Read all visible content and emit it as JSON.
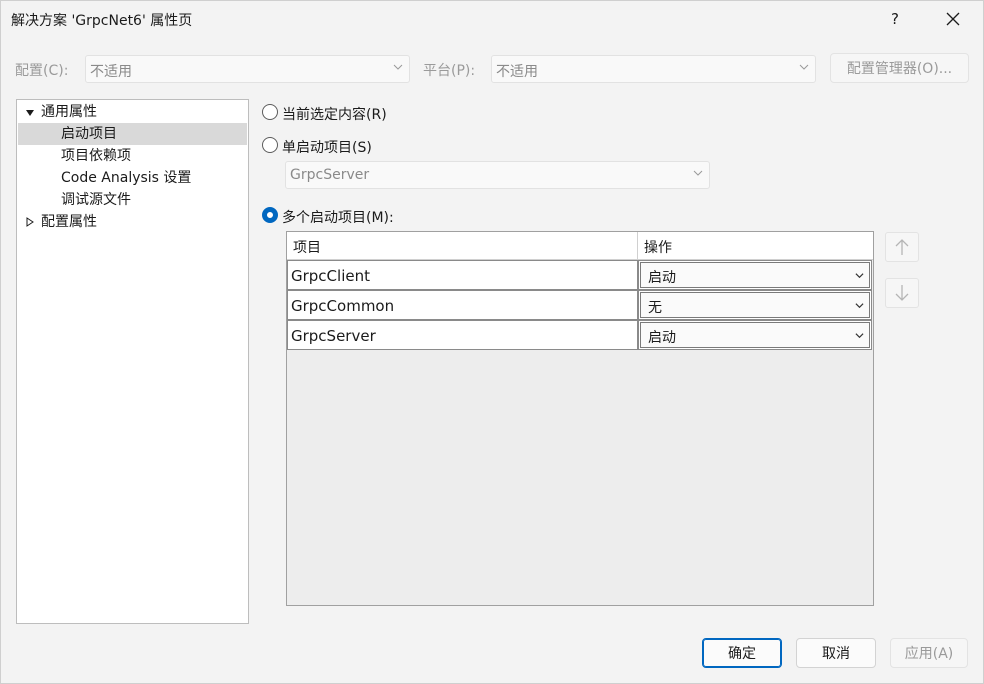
{
  "window": {
    "title": "解决方案 'GrpcNet6' 属性页",
    "help": "?",
    "close": "✕"
  },
  "config": {
    "config_label": "配置(C):",
    "config_value": "不适用",
    "platform_label": "平台(P):",
    "platform_value": "不适用",
    "manager_button": "配置管理器(O)..."
  },
  "tree": {
    "items": [
      {
        "label": "通用属性"
      },
      {
        "label": "启动项目"
      },
      {
        "label": "项目依赖项"
      },
      {
        "label": "Code Analysis 设置"
      },
      {
        "label": "调试源文件"
      },
      {
        "label": "配置属性"
      }
    ]
  },
  "startup": {
    "current_selection": "当前选定内容(R)",
    "single": "单启动项目(S)",
    "single_value": "GrpcServer",
    "multiple": "多个启动项目(M):",
    "selected": "multiple"
  },
  "grid": {
    "headers": [
      "项目",
      "操作"
    ],
    "rows": [
      {
        "project": "GrpcClient",
        "action": "启动"
      },
      {
        "project": "GrpcCommon",
        "action": "无"
      },
      {
        "project": "GrpcServer",
        "action": "启动"
      }
    ]
  },
  "icons": {
    "move_up": "arrow-up-icon",
    "move_down": "arrow-down-icon"
  },
  "buttons": {
    "ok": "确定",
    "cancel": "取消",
    "apply": "应用(A)"
  },
  "colors": {
    "accent": "#0067c0",
    "selection": "#d9d9d9",
    "disabled_text": "#9a9a9a"
  }
}
